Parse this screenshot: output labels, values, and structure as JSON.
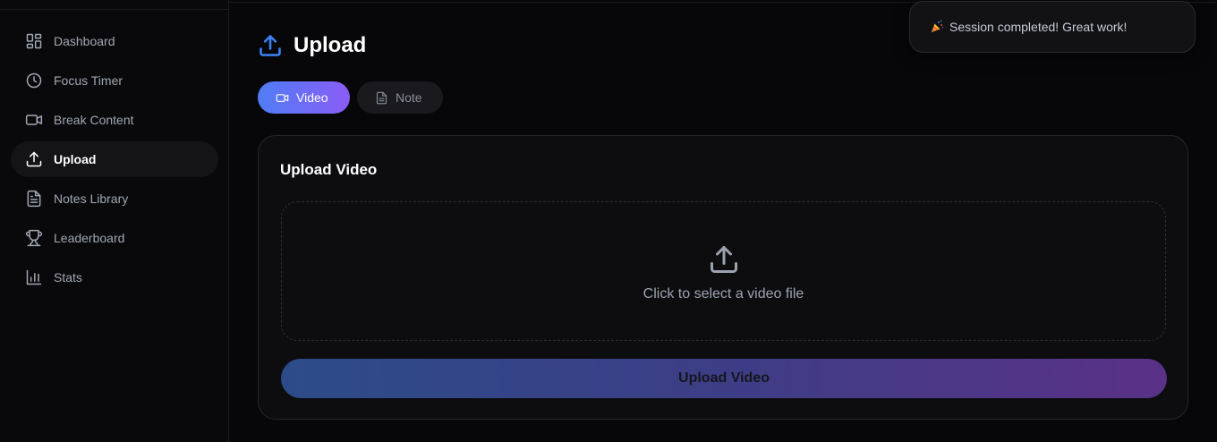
{
  "sidebar": {
    "items": [
      {
        "label": "Dashboard",
        "icon": "layout-grid-icon",
        "active": false
      },
      {
        "label": "Focus Timer",
        "icon": "clock-icon",
        "active": false
      },
      {
        "label": "Break Content",
        "icon": "video-icon",
        "active": false
      },
      {
        "label": "Upload",
        "icon": "upload-icon",
        "active": true
      },
      {
        "label": "Notes Library",
        "icon": "file-text-icon",
        "active": false
      },
      {
        "label": "Leaderboard",
        "icon": "trophy-icon",
        "active": false
      },
      {
        "label": "Stats",
        "icon": "bar-chart-icon",
        "active": false
      }
    ]
  },
  "header": {
    "title": "Upload",
    "icon": "upload-icon"
  },
  "tabs": [
    {
      "label": "Video",
      "icon": "video-icon",
      "active": true
    },
    {
      "label": "Note",
      "icon": "file-text-icon",
      "active": false
    }
  ],
  "card": {
    "title": "Upload Video",
    "dropzone_text": "Click to select a video file",
    "button_label": "Upload Video"
  },
  "toast": {
    "message": "Session completed! Great work!",
    "icon": "party-popper-icon"
  },
  "colors": {
    "accent_blue": "#3b82f6",
    "accent_purple": "#8b5cf6",
    "background": "#070709"
  }
}
